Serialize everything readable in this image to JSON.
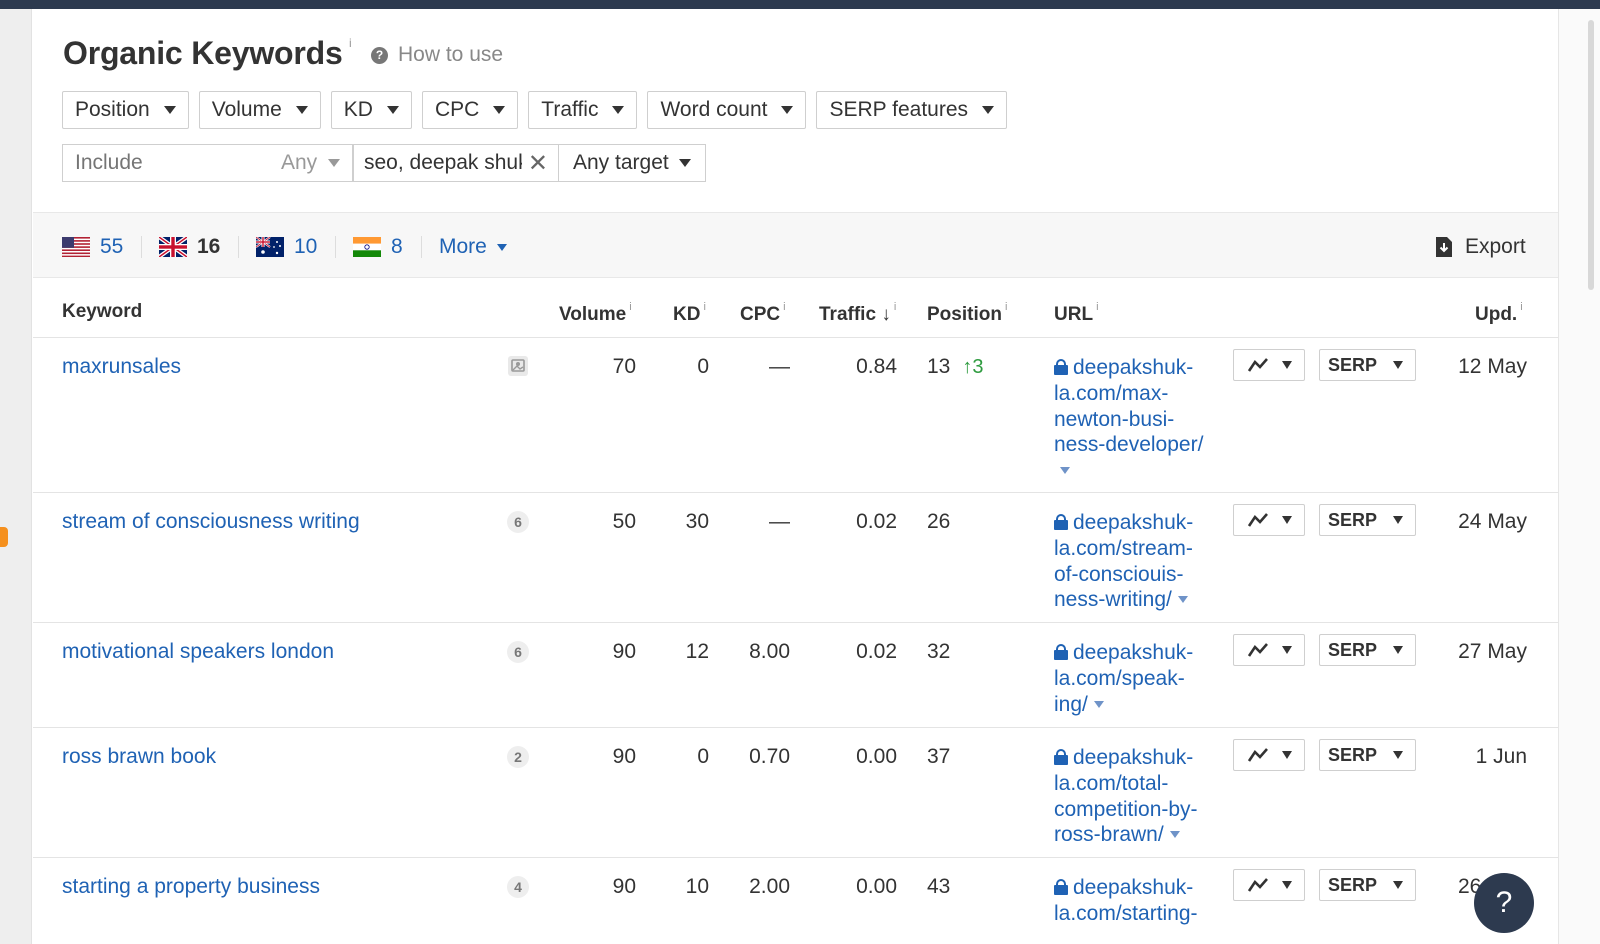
{
  "header": {
    "title": "Organic Keywords",
    "title_info": "i",
    "how_to_use": "How to use"
  },
  "filters": [
    {
      "label": "Position"
    },
    {
      "label": "Volume"
    },
    {
      "label": "KD"
    },
    {
      "label": "CPC"
    },
    {
      "label": "Traffic"
    },
    {
      "label": "Word count"
    },
    {
      "label": "SERP features"
    }
  ],
  "search": {
    "include_placeholder": "Include",
    "any_label": "Any",
    "keyword_chip": "seo, deepak shukla",
    "target_label": "Any target"
  },
  "countries": [
    {
      "flag": "us-flag",
      "count": "55"
    },
    {
      "flag": "uk-flag",
      "count": "16"
    },
    {
      "flag": "au-flag",
      "count": "10"
    },
    {
      "flag": "in-flag",
      "count": "8"
    }
  ],
  "more_label": "More",
  "export_label": "Export",
  "columns": {
    "keyword": "Keyword",
    "volume": "Volume",
    "kd": "KD",
    "cpc": "CPC",
    "traffic": "Traffic",
    "traffic_sort": "↓",
    "position": "Position",
    "url": "URL",
    "updated": "Upd.",
    "info": "i"
  },
  "rows": [
    {
      "keyword": "maxrunsales",
      "serp_features": "",
      "volume": "70",
      "kd": "0",
      "cpc": "—",
      "traffic": "0.84",
      "position": "13",
      "position_change": "↑3",
      "url": "deepakshuk-la.com/max-newton-busi-ness-developer/",
      "serp_label": "SERP",
      "updated": "12 May"
    },
    {
      "keyword": "stream of consciousness writing",
      "serp_features": "6",
      "volume": "50",
      "kd": "30",
      "cpc": "—",
      "traffic": "0.02",
      "position": "26",
      "position_change": "",
      "url": "deepakshuk-la.com/stream-of-consciouis-ness-writing/",
      "serp_label": "SERP",
      "updated": "24 May"
    },
    {
      "keyword": "motivational speakers london",
      "serp_features": "6",
      "volume": "90",
      "kd": "12",
      "cpc": "8.00",
      "traffic": "0.02",
      "position": "32",
      "position_change": "",
      "url": "deepakshuk-la.com/speak-ing/",
      "serp_label": "SERP",
      "updated": "27 May"
    },
    {
      "keyword": "ross brawn book",
      "serp_features": "2",
      "volume": "90",
      "kd": "0",
      "cpc": "0.70",
      "traffic": "0.00",
      "position": "37",
      "position_change": "",
      "url": "deepakshuk-la.com/total-competition-by-ross-brawn/",
      "serp_label": "SERP",
      "updated": "1 Jun"
    },
    {
      "keyword": "starting a property business",
      "serp_features": "4",
      "volume": "90",
      "kd": "10",
      "cpc": "2.00",
      "traffic": "0.00",
      "position": "43",
      "position_change": "",
      "url": "deepakshuk-la.com/starting-",
      "serp_label": "SERP",
      "updated": "26"
    }
  ],
  "help_label": "?"
}
